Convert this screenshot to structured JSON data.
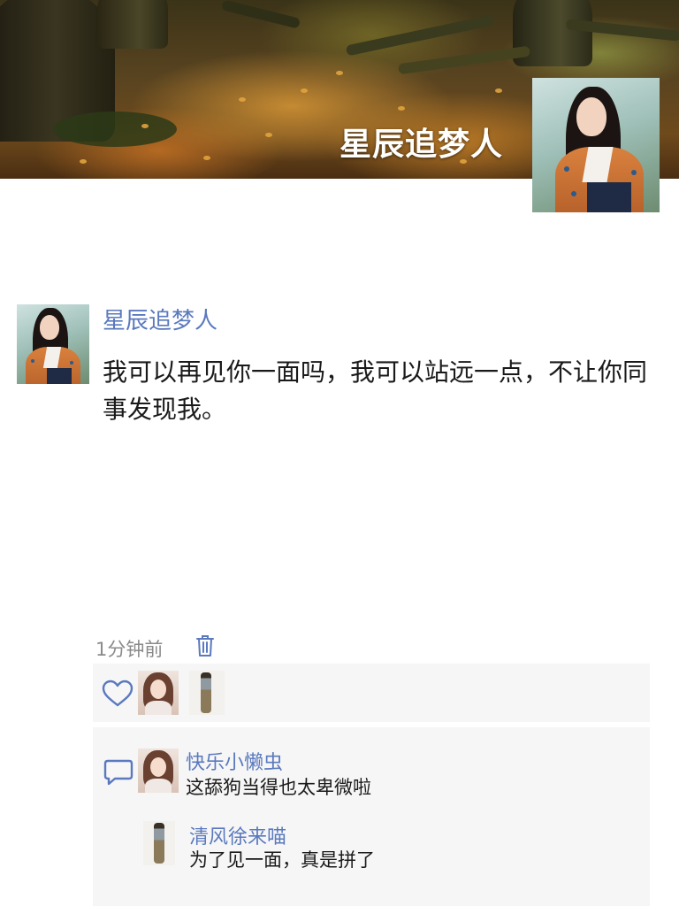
{
  "cover": {
    "name": "星辰追梦人"
  },
  "post": {
    "author": "星辰追梦人",
    "text": "我可以再见你一面吗，我可以站远一点，不让你同事发现我。",
    "time": "1分钟前"
  },
  "likes": {
    "icon": "heart-icon",
    "likers": [
      "avatar-girl",
      "avatar-standing-person"
    ]
  },
  "comments": [
    {
      "name": "快乐小懒虫",
      "text": "这舔狗当得也太卑微啦"
    },
    {
      "name": "清风徐来喵",
      "text": "为了见一面，真是拼了"
    }
  ],
  "colors": {
    "link_blue": "#5a79be",
    "panel_bg": "#f6f6f6",
    "muted_text": "#8a8a8a"
  }
}
